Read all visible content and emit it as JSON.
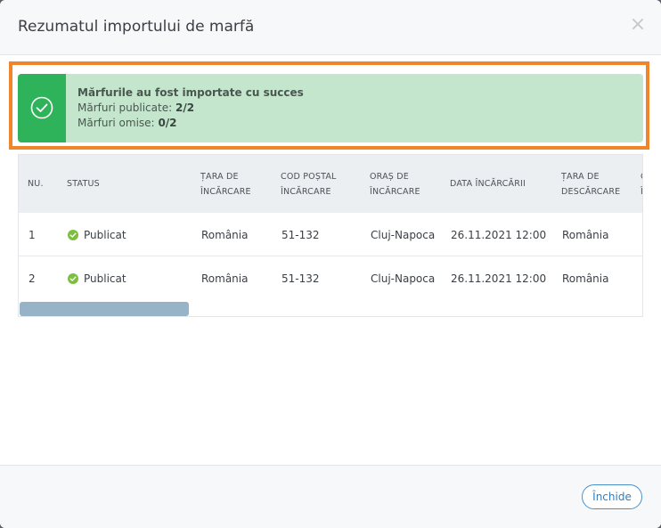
{
  "modal": {
    "title": "Rezumatul importului de marfă",
    "close_glyph": "×"
  },
  "alert": {
    "title": "Mărfurile au fost importate cu succes",
    "published_label": "Mărfuri publicate:",
    "published_value": "2/2",
    "omitted_label": "Mărfuri omise:",
    "omitted_value": "0/2",
    "icon": "check-circle-icon",
    "color": "#2fb35a"
  },
  "highlight_color": "#f0862b",
  "table": {
    "columns": [
      {
        "line1": "NU.",
        "line2": ""
      },
      {
        "line1": "STATUS",
        "line2": ""
      },
      {
        "line1": "ȚARA DE",
        "line2": "ÎNCĂRCARE"
      },
      {
        "line1": "COD POȘTAL",
        "line2": "ÎNCĂRCARE"
      },
      {
        "line1": "ORAȘ DE",
        "line2": "ÎNCĂRCARE"
      },
      {
        "line1": "DATA ÎNCĂRCĂRII",
        "line2": ""
      },
      {
        "line1": "ȚARA DE",
        "line2": "DESCĂRCARE"
      },
      {
        "line1": "C",
        "line2": "Î"
      }
    ],
    "rows": [
      {
        "nr": "1",
        "status": "Publicat",
        "country": "România",
        "postal": "51-132",
        "city": "Cluj-Napoca",
        "date": "26.11.2021 12:00",
        "unload_country": "România"
      },
      {
        "nr": "2",
        "status": "Publicat",
        "country": "România",
        "postal": "51-132",
        "city": "Cluj-Napoca",
        "date": "26.11.2021 12:00",
        "unload_country": "România"
      }
    ]
  },
  "footer": {
    "close_label": "Închide"
  }
}
